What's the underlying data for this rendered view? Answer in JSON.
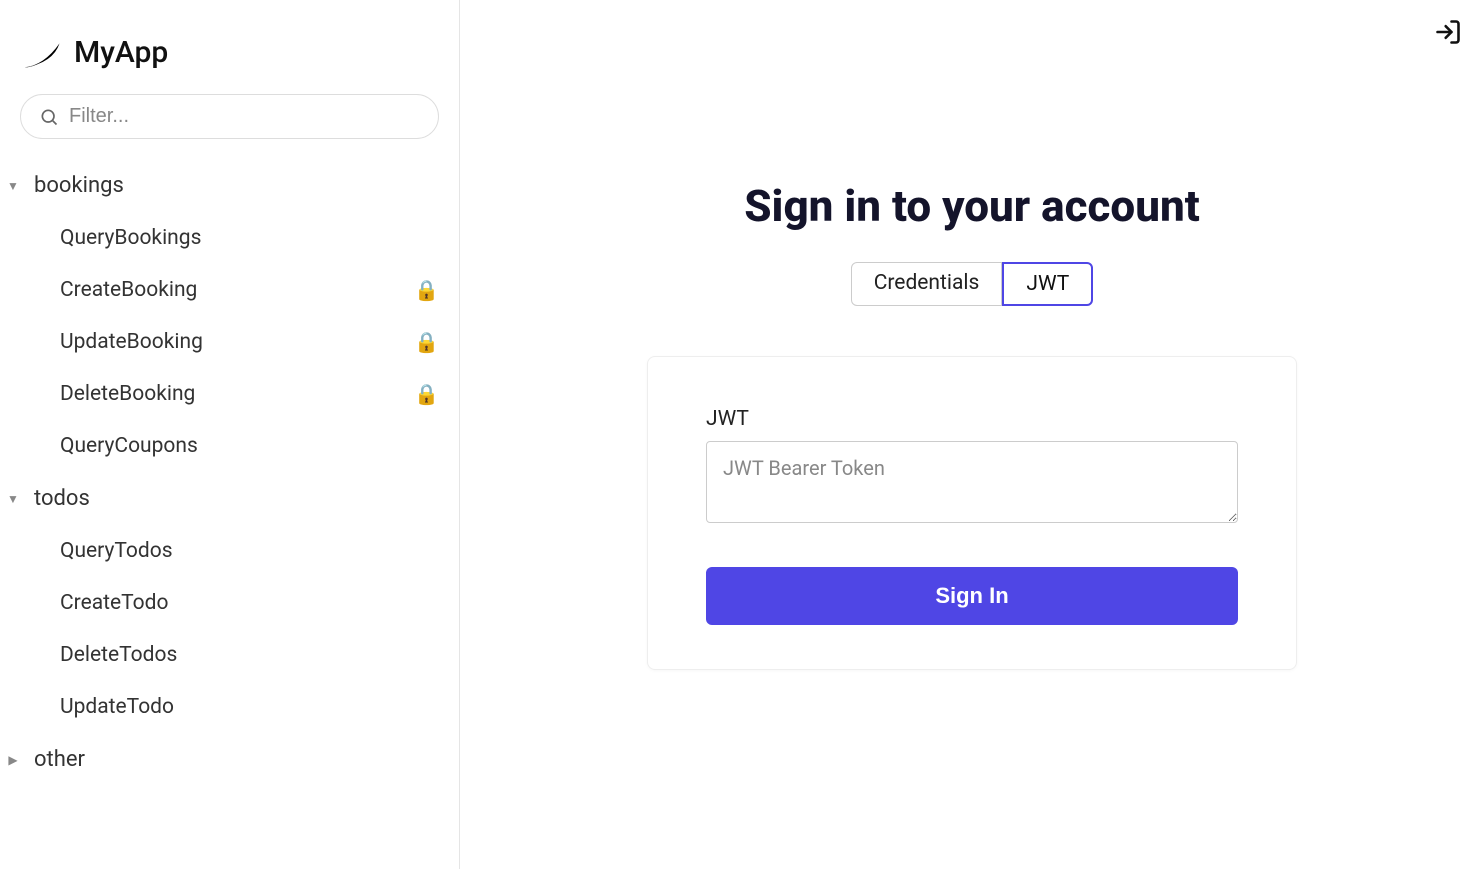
{
  "app": {
    "name": "MyApp"
  },
  "sidebar": {
    "search_placeholder": "Filter...",
    "groups": [
      {
        "title": "bookings",
        "expanded": true,
        "items": [
          {
            "label": "QueryBookings",
            "locked": false
          },
          {
            "label": "CreateBooking",
            "locked": true
          },
          {
            "label": "UpdateBooking",
            "locked": true
          },
          {
            "label": "DeleteBooking",
            "locked": true
          },
          {
            "label": "QueryCoupons",
            "locked": false
          }
        ]
      },
      {
        "title": "todos",
        "expanded": true,
        "items": [
          {
            "label": "QueryTodos",
            "locked": false
          },
          {
            "label": "CreateTodo",
            "locked": false
          },
          {
            "label": "DeleteTodos",
            "locked": false
          },
          {
            "label": "UpdateTodo",
            "locked": false
          }
        ]
      },
      {
        "title": "other",
        "expanded": false,
        "items": []
      }
    ]
  },
  "main": {
    "title": "Sign in to your account",
    "tabs": {
      "credentials": "Credentials",
      "jwt": "JWT",
      "active": "jwt"
    },
    "form": {
      "jwt_label": "JWT",
      "jwt_placeholder": "JWT Bearer Token",
      "signin_button": "Sign In"
    }
  }
}
